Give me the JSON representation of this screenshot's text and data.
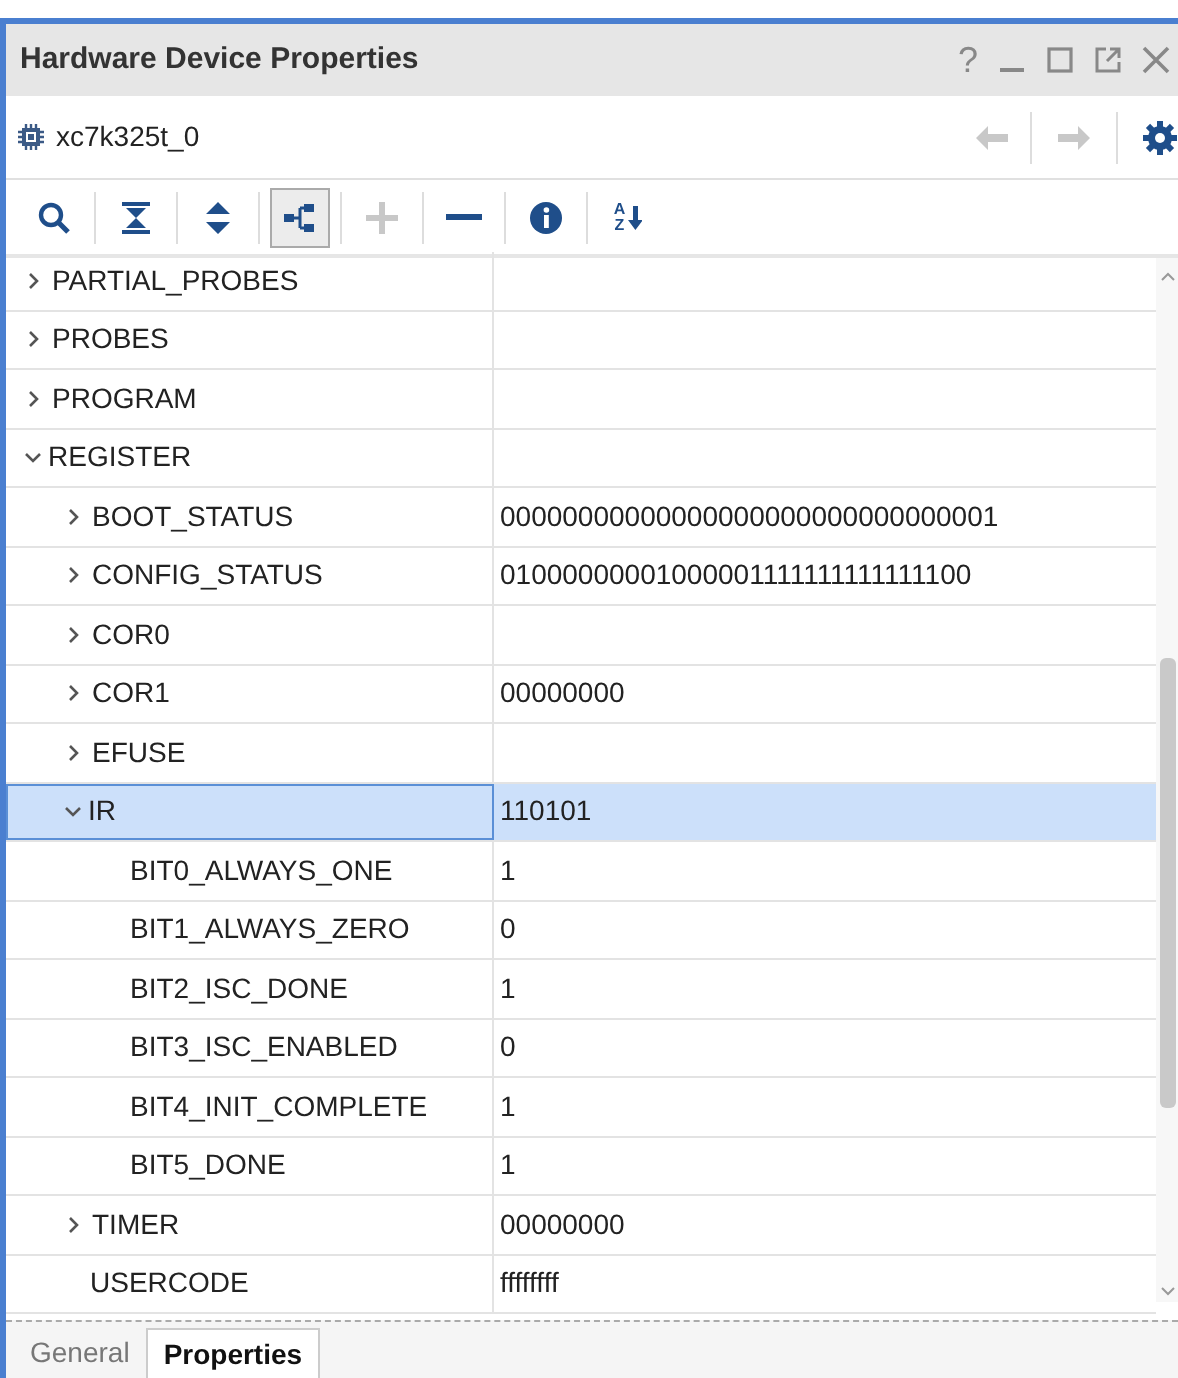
{
  "window": {
    "title": "Hardware Device Properties",
    "controls": [
      "?"
    ]
  },
  "device": {
    "name": "xc7k325t_0"
  },
  "toolbar": [
    {
      "kind": "search",
      "disabled": false,
      "selected": false
    },
    {
      "kind": "collapse",
      "disabled": false,
      "selected": false
    },
    {
      "kind": "expand",
      "disabled": false,
      "selected": false
    },
    {
      "kind": "hierarchy",
      "disabled": false,
      "selected": true
    },
    {
      "kind": "plus",
      "disabled": true,
      "selected": false
    },
    {
      "kind": "minus",
      "disabled": false,
      "selected": false
    },
    {
      "kind": "info",
      "disabled": false,
      "selected": false
    },
    {
      "kind": "sort",
      "disabled": false,
      "selected": false,
      "letters": [
        "A",
        "Z"
      ]
    }
  ],
  "properties": [
    {
      "name": "PARTIAL_PROBES",
      "expanded": false,
      "selected": false
    },
    {
      "name": "PROBES",
      "expanded": false,
      "selected": false
    },
    {
      "name": "PROGRAM",
      "expanded": false,
      "selected": false
    },
    {
      "name": "REGISTER",
      "expanded": true,
      "selected": false,
      "children": [
        {
          "name": "BOOT_STATUS",
          "value": "00000000000000000000000000000001",
          "expanded": false,
          "selected": false
        },
        {
          "name": "CONFIG_STATUS",
          "value": "01000000001000001111111111111100",
          "expanded": false,
          "selected": false
        },
        {
          "name": "COR0",
          "expanded": false,
          "selected": false
        },
        {
          "name": "COR1",
          "value": "00000000",
          "expanded": false,
          "selected": false
        },
        {
          "name": "EFUSE",
          "expanded": false,
          "selected": false
        },
        {
          "name": "IR",
          "value": "110101",
          "expanded": true,
          "selected": true,
          "children": [
            {
              "name": "BIT0_ALWAYS_ONE",
              "value": "1",
              "selected": false
            },
            {
              "name": "BIT1_ALWAYS_ZERO",
              "value": "0",
              "selected": false
            },
            {
              "name": "BIT2_ISC_DONE",
              "value": "1",
              "selected": false
            },
            {
              "name": "BIT3_ISC_ENABLED",
              "value": "0",
              "selected": false
            },
            {
              "name": "BIT4_INIT_COMPLETE",
              "value": "1",
              "selected": false
            },
            {
              "name": "BIT5_DONE",
              "value": "1",
              "selected": false
            }
          ]
        },
        {
          "name": "TIMER",
          "value": "00000000",
          "expanded": false,
          "selected": false
        },
        {
          "name": "USERCODE",
          "value": "ffffffff",
          "selected": false
        }
      ]
    }
  ],
  "tabs": [
    {
      "label": "General",
      "selected": false
    },
    {
      "label": "Properties",
      "selected": true
    }
  ]
}
